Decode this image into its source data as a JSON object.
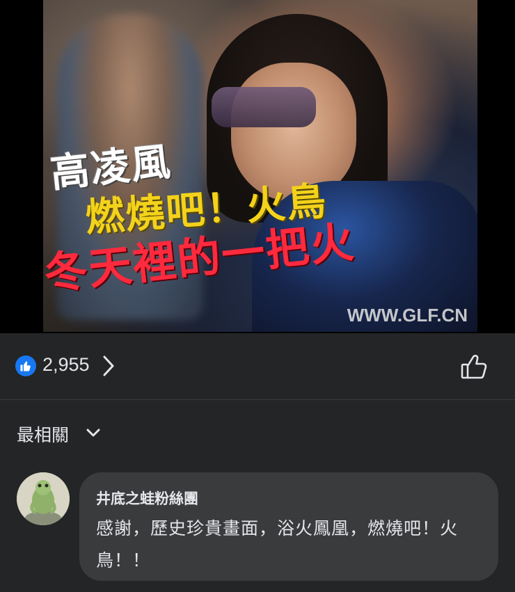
{
  "video": {
    "caption_line1": "高凌風",
    "caption_line2": "燃燒吧！火鳥",
    "caption_line3": "冬天裡的一把火",
    "watermark": "WWW.GLF.CN"
  },
  "reactions": {
    "count": "2,955",
    "icon": "thumbs-up-icon",
    "accent_color": "#1877f2"
  },
  "sort": {
    "label": "最相關",
    "icon": "chevron-down-icon"
  },
  "comment": {
    "author": "井底之蛙粉絲團",
    "text": "感謝，歷史珍貴畫面，浴火鳳凰，燃燒吧！火鳥！！"
  }
}
